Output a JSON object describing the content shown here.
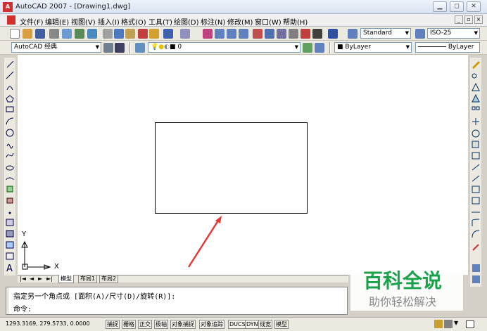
{
  "window": {
    "title": "AutoCAD 2007 - [Drawing1.dwg]",
    "app_icon": "autocad-icon"
  },
  "menu": [
    "文件(F)",
    "编辑(E)",
    "视图(V)",
    "插入(I)",
    "格式(O)",
    "工具(T)",
    "绘图(D)",
    "标注(N)",
    "修改(M)",
    "窗口(W)",
    "帮助(H)"
  ],
  "toolbar": {
    "text_style": "Standard",
    "dim_style": "ISO-25",
    "workspace": "AutoCAD 经典",
    "layer": "0",
    "color": "ByLayer",
    "linetype": "ByLayer"
  },
  "tabs": [
    "模型",
    "布局1",
    "布局2"
  ],
  "ucs": {
    "x_label": "X",
    "y_label": "Y"
  },
  "command": {
    "line1": "指定另一个角点或 [面积(A)/尺寸(D)/旋转(R)]:",
    "line2": "命令:"
  },
  "status": {
    "coords": "1293.3169, 279.5733, 0.0000",
    "buttons": [
      "捕捉",
      "栅格",
      "正交",
      "极轴",
      "对象捕捉",
      "对象追踪",
      "DUCS",
      "DYN",
      "线宽",
      "模型"
    ]
  },
  "watermark": {
    "title": "百科全说",
    "subtitle": "助你轻松解决"
  },
  "colors": {
    "arrow": "#e53935",
    "watermark_green": "#1aa24a"
  }
}
